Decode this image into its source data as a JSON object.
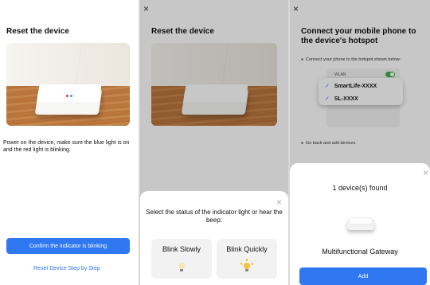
{
  "panel1": {
    "title": "Reset the device",
    "instruction": "Power on the device, make sure the blue light is on and the red light is blinking.",
    "confirm_button": "Confirm the indicator is blinking",
    "reset_link": "Reset Device Step by Step"
  },
  "panel2": {
    "close_glyph": "×",
    "title": "Reset the device",
    "sheet_close_glyph": "×",
    "prompt": "Select the status of the indicator light or hear the beep:",
    "options": [
      {
        "label": "Blink Slowly",
        "icon": "bulb-icon"
      },
      {
        "label": "Blink Quickly",
        "icon": "bulb-glowing-icon"
      }
    ]
  },
  "panel3": {
    "close_glyph": "×",
    "title": "Connect your mobile phone to the device's hotspot",
    "step1": "Connect your phone to the hotspot shown below:",
    "wlan_label": "WLAN",
    "ssids": [
      {
        "check": "✓",
        "name": "SmartLife-XXXX"
      },
      {
        "check": "✓",
        "name": "SL-XXXX"
      }
    ],
    "step2": "Go back and add devices.",
    "sheet_close_glyph": "×",
    "found_text": "1 device(s) found",
    "device_name": "Multifunctional Gateway",
    "add_button": "Add"
  },
  "colors": {
    "primary": "#2f78f2",
    "toggle_on": "#3bb34a",
    "check": "#3a6fe0"
  }
}
